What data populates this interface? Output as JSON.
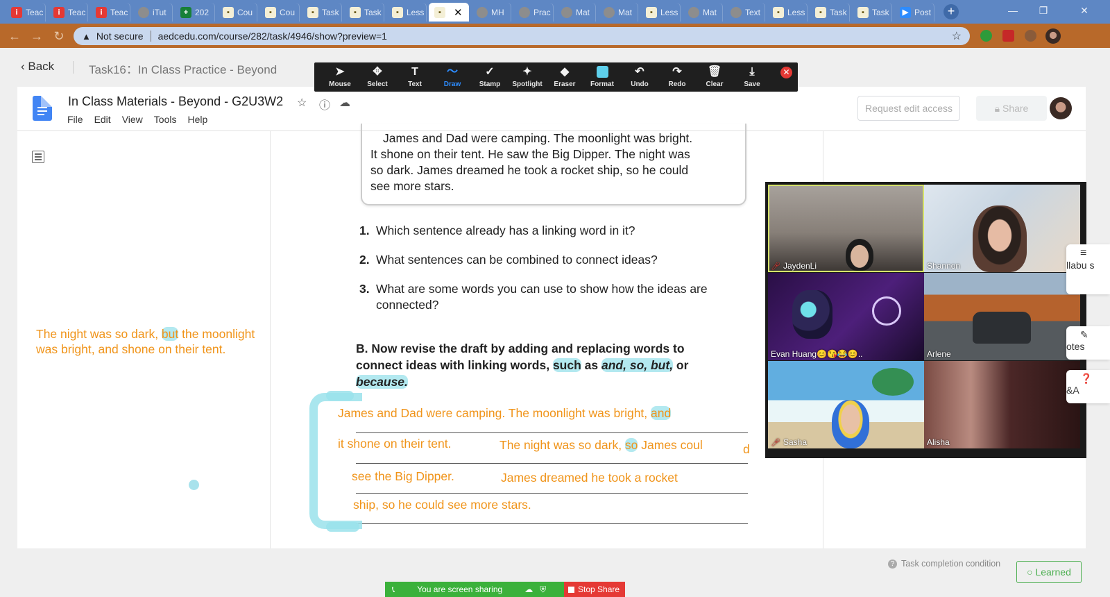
{
  "browser": {
    "tabs": [
      {
        "label": "Teac",
        "favicon": "red-i"
      },
      {
        "label": "Teac",
        "favicon": "red-i"
      },
      {
        "label": "Teac",
        "favicon": "red-i"
      },
      {
        "label": "iTut",
        "favicon": "gray-circle"
      },
      {
        "label": "202",
        "favicon": "green-sheet"
      },
      {
        "label": "Cou",
        "favicon": "cream-doc"
      },
      {
        "label": "Cou",
        "favicon": "cream-doc"
      },
      {
        "label": "Task",
        "favicon": "cream-doc"
      },
      {
        "label": "Task",
        "favicon": "cream-doc"
      },
      {
        "label": "Less",
        "favicon": "cream-doc"
      },
      {
        "label": "",
        "favicon": "cream-doc",
        "active": true
      },
      {
        "label": "MH",
        "favicon": "gray-circle"
      },
      {
        "label": "Prac",
        "favicon": "gray-circle"
      },
      {
        "label": "Mat",
        "favicon": "gray-circle"
      },
      {
        "label": "Mat",
        "favicon": "gray-circle"
      },
      {
        "label": "Less",
        "favicon": "cream-doc"
      },
      {
        "label": "Mat",
        "favicon": "gray-circle"
      },
      {
        "label": "Text",
        "favicon": "gray-circle"
      },
      {
        "label": "Less",
        "favicon": "cream-doc"
      },
      {
        "label": "Task",
        "favicon": "cream-doc"
      },
      {
        "label": "Task",
        "favicon": "cream-doc"
      },
      {
        "label": "Post",
        "favicon": "zoom-blue"
      }
    ],
    "security": "Not secure",
    "url": "aedcedu.com/course/282/task/4946/show?preview=1"
  },
  "page": {
    "back_label": "Back",
    "task_title": "Task16：In Class Practice - Beyond"
  },
  "doc": {
    "title": "In Class Materials - Beyond - G2U3W2",
    "menu": [
      "File",
      "Edit",
      "View",
      "Tools",
      "Help"
    ],
    "request_edit_label": "Request edit access",
    "share_label": "Share"
  },
  "worksheet": {
    "story_lines": [
      "James and Dad were camping. The moonlight was bright.",
      "It shone on their tent. He saw the Big Dipper. The night was",
      "so dark. James dreamed he took a rocket ship, so he could",
      "see more stars."
    ],
    "questions": [
      {
        "num": "1.",
        "text": "Which sentence already has a linking word in it?"
      },
      {
        "num": "2.",
        "text": "What sentences can be combined to connect ideas?"
      },
      {
        "num": "3.",
        "text": "What are some words you can use to show how the ideas are",
        "text2": "connected?"
      }
    ],
    "partB": {
      "line1": "B. Now revise the draft by adding and replacing words to",
      "line2_pre": "connect ideas with linking words, ",
      "such": "such",
      "as": " as ",
      "words": "and, so, but,",
      "or": " or",
      "because": "because."
    },
    "handwriting": {
      "line1_a": "James and Dad were camping.  The moonlight was bright, ",
      "line1_and": "and",
      "line2_a": "it shone on their tent.",
      "line2_b": "The night was so dark, ",
      "line2_so": "so",
      "line2_c": " James coul",
      "line2_d": "d",
      "line3_a": "see the Big Dipper.",
      "line3_b": "James dreamed he took a rocket",
      "line4": "ship, so he could see more stars."
    },
    "left_note": {
      "pre": "The night was so dark, ",
      "but": "but",
      "post": " the moonlight was bright, and shone on their tent."
    }
  },
  "annotation_toolbar": {
    "tools": [
      {
        "label": "Mouse",
        "icon": "cursor-icon",
        "glyph": "➤"
      },
      {
        "label": "Select",
        "icon": "move-icon",
        "glyph": "✥"
      },
      {
        "label": "Text",
        "icon": "text-icon",
        "glyph": "T"
      },
      {
        "label": "Draw",
        "icon": "draw-icon",
        "glyph": "〜",
        "active": true
      },
      {
        "label": "Stamp",
        "icon": "check-icon",
        "glyph": "✓"
      },
      {
        "label": "Spotlight",
        "icon": "spotlight-icon",
        "glyph": "✦"
      },
      {
        "label": "Eraser",
        "icon": "eraser-icon",
        "glyph": "◆"
      },
      {
        "label": "Format",
        "icon": "format-icon",
        "glyph": ""
      },
      {
        "label": "Undo",
        "icon": "undo-icon",
        "glyph": "↶"
      },
      {
        "label": "Redo",
        "icon": "redo-icon",
        "glyph": "↷"
      },
      {
        "label": "Clear",
        "icon": "trash-icon",
        "glyph": "🗑"
      },
      {
        "label": "Save",
        "icon": "save-icon",
        "glyph": "⤓"
      }
    ],
    "format_color": "#5ed0ec"
  },
  "gallery": {
    "participants": [
      {
        "name": "JaydenLi",
        "muted": true,
        "speaking": true
      },
      {
        "name": "Shannon",
        "muted": false
      },
      {
        "name": "Evan Huang😊😘😂😊..",
        "muted": false
      },
      {
        "name": "Arlene",
        "muted": false
      },
      {
        "name": "Sasha",
        "muted": true
      },
      {
        "name": "Alisha",
        "muted": false
      }
    ]
  },
  "side_tabs": [
    "llabu s",
    "otes",
    "&A"
  ],
  "footer": {
    "task_condition": "Task completion condition",
    "learned": "Learned",
    "sharing_text": "You are screen sharing",
    "stop_share": "Stop Share"
  },
  "colors": {
    "handwriting": "#f0941a",
    "highlight": "#9ae2eb",
    "tab_strip": "#5e87c4",
    "address_bar": "#b8692a",
    "learned": "#4caf50",
    "stop_share": "#e53935",
    "sharing": "#3bb13b"
  }
}
